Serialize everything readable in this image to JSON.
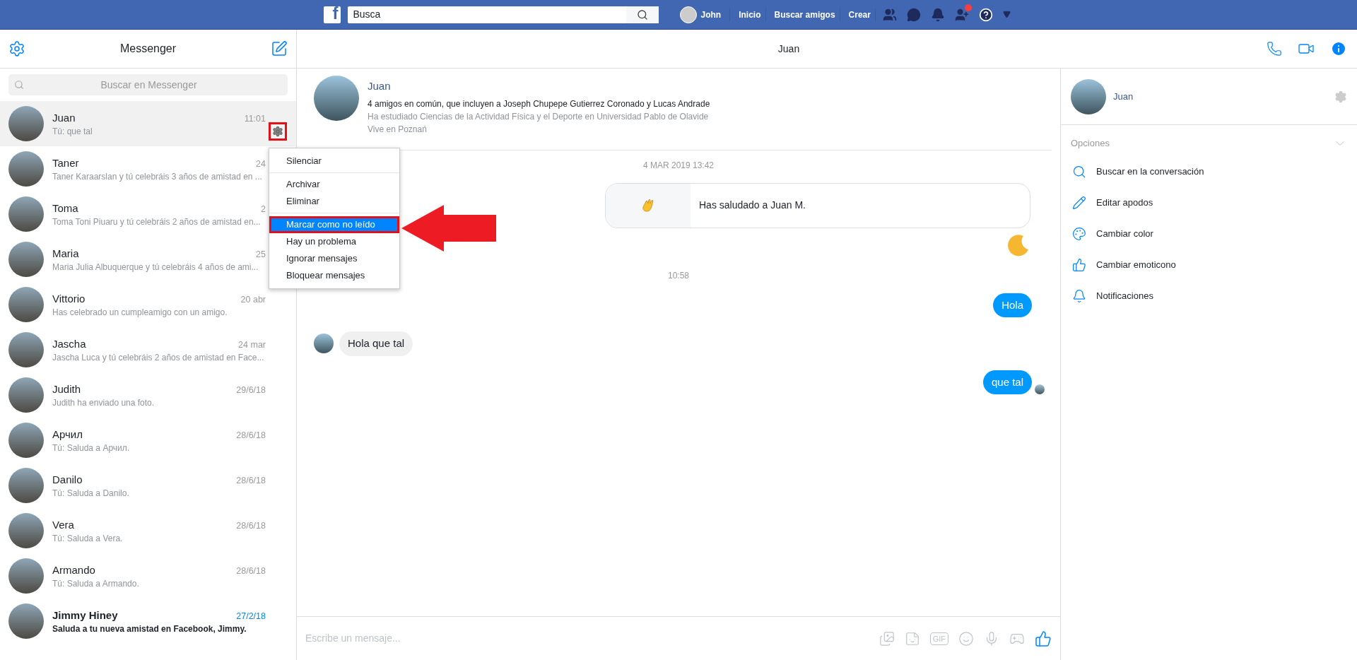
{
  "topbar": {
    "logo": "f",
    "search": {
      "placeholder": "Busca"
    },
    "user": "John",
    "links": [
      "Inicio",
      "Buscar amigos",
      "Crear"
    ],
    "friend_requests_dot": true
  },
  "sidebar": {
    "title": "Messenger",
    "search": {
      "placeholder": "Buscar en Messenger"
    },
    "conversations": [
      {
        "name": "Juan",
        "preview": "Tú: que tal",
        "time": "11:01",
        "selected": true,
        "unread": false
      },
      {
        "name": "Taner",
        "preview": "Taner Karaarslan y tú celebráis 3 años de amistad en ...",
        "time": "24",
        "selected": false,
        "unread": false
      },
      {
        "name": "Toma",
        "preview": "Toma Toni Piuaru y tú celebráis 2 años de amistad en...",
        "time": "2",
        "selected": false,
        "unread": false
      },
      {
        "name": "Maria",
        "preview": "Maria Julia Albuquerque y tú celebráis 4 años de ami...",
        "time": "25",
        "selected": false,
        "unread": false
      },
      {
        "name": "Vittorio",
        "preview": "Has celebrado un cumpleamigo con un amigo.",
        "time": "20 abr",
        "selected": false,
        "unread": false
      },
      {
        "name": "Jascha",
        "preview": "Jascha Luca y tú celebráis 2 años de amistad en Face...",
        "time": "24 mar",
        "selected": false,
        "unread": false
      },
      {
        "name": "Judith",
        "preview": "Judith ha enviado una foto.",
        "time": "29/6/18",
        "selected": false,
        "unread": false
      },
      {
        "name": "Арчил",
        "preview": "Tú: Saluda a Арчил.",
        "time": "28/6/18",
        "selected": false,
        "unread": false
      },
      {
        "name": "Danilo",
        "preview": "Tú: Saluda a Danilo.",
        "time": "28/6/18",
        "selected": false,
        "unread": false
      },
      {
        "name": "Vera",
        "preview": "Tú: Saluda a Vera.",
        "time": "28/6/18",
        "selected": false,
        "unread": false
      },
      {
        "name": "Armando",
        "preview": "Tú: Saluda a Armando.",
        "time": "28/6/18",
        "selected": false,
        "unread": false
      },
      {
        "name": "Jimmy Hiney",
        "preview": "Saluda a tu nueva amistad en Facebook, Jimmy.",
        "time": "27/2/18",
        "selected": false,
        "unread": true
      }
    ]
  },
  "context_menu": {
    "groups": [
      [
        {
          "label": "Silenciar",
          "selected": false,
          "annotated": false
        }
      ],
      [
        {
          "label": "Archivar",
          "selected": false,
          "annotated": false
        },
        {
          "label": "Eliminar",
          "selected": false,
          "annotated": false
        }
      ],
      [
        {
          "label": "Marcar como no leído",
          "selected": true,
          "annotated": true
        },
        {
          "label": "Hay un problema",
          "selected": false,
          "annotated": false
        },
        {
          "label": "Ignorar mensajes",
          "selected": false,
          "annotated": false
        },
        {
          "label": "Bloquear mensajes",
          "selected": false,
          "annotated": false
        }
      ]
    ]
  },
  "chat": {
    "title": "Juan",
    "intro": {
      "name": "Juan",
      "mutual": "4 amigos en común, que incluyen a Joseph Chupepe Gutierrez Coronado y Lucas Andrade",
      "studies": "Ha estudiado Ciencias de la Actividad Física y el Deporte en Universidad Pablo de Olavide",
      "lives": "Vive en Poznań"
    },
    "messages": [
      {
        "kind": "date",
        "text": "4 MAR 2019 13:42"
      },
      {
        "kind": "wave",
        "text": "Has saludado a Juan M."
      },
      {
        "kind": "moon"
      },
      {
        "kind": "date",
        "text": "10:58"
      },
      {
        "kind": "outgoing",
        "text": "Hola",
        "seen": false
      },
      {
        "kind": "incoming",
        "text": "Hola que tal"
      },
      {
        "kind": "outgoing",
        "text": "que tal",
        "seen": true
      }
    ],
    "composer": {
      "placeholder": "Escribe un mensaje...",
      "gif": "GIF"
    }
  },
  "details": {
    "name": "Juan",
    "options_title": "Opciones",
    "options": [
      {
        "kind": "search",
        "label": "Buscar en la conversación"
      },
      {
        "kind": "nickname",
        "label": "Editar apodos"
      },
      {
        "kind": "color",
        "label": "Cambiar color"
      },
      {
        "kind": "emoji",
        "label": "Cambiar emoticono"
      },
      {
        "kind": "notifications",
        "label": "Notificaciones"
      }
    ]
  }
}
